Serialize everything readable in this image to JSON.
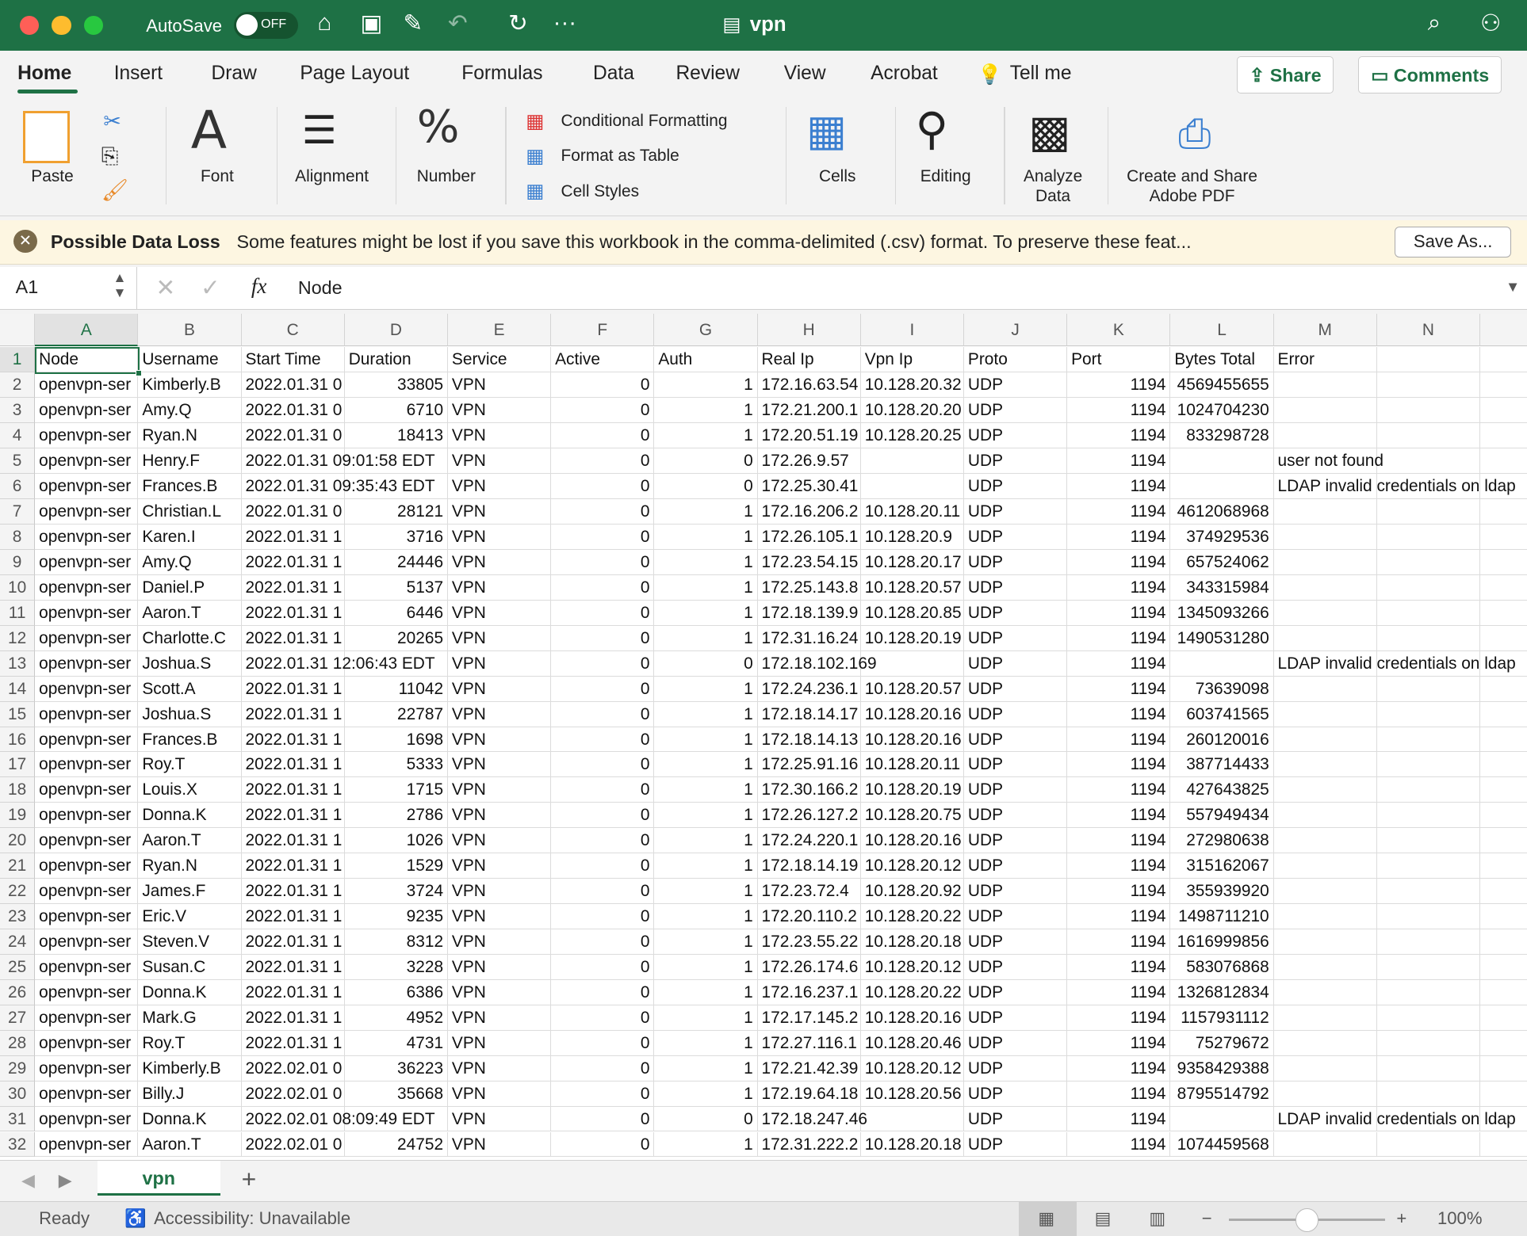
{
  "titlebar": {
    "autosave": "AutoSave",
    "toggle": "OFF",
    "filename": "vpn",
    "icons": [
      "home-icon",
      "save-icon",
      "save-as-icon",
      "undo-icon",
      "redo-icon",
      "more-icon",
      "search-icon",
      "share-people-icon"
    ]
  },
  "tabs": [
    {
      "label": "Home",
      "active": true
    },
    {
      "label": "Insert"
    },
    {
      "label": "Draw"
    },
    {
      "label": "Page Layout"
    },
    {
      "label": "Formulas"
    },
    {
      "label": "Data"
    },
    {
      "label": "Review"
    },
    {
      "label": "View"
    },
    {
      "label": "Acrobat"
    },
    {
      "label": "Tell me"
    }
  ],
  "share": "Share",
  "comments": "Comments",
  "ribbon": {
    "paste": "Paste",
    "font": "Font",
    "alignment": "Alignment",
    "number": "Number",
    "conditional": "Conditional Formatting",
    "format_table": "Format as Table",
    "cell_styles": "Cell Styles",
    "cells": "Cells",
    "editing": "Editing",
    "analyze1": "Analyze",
    "analyze2": "Data",
    "pdf1": "Create and Share",
    "pdf2": "Adobe PDF"
  },
  "warning": {
    "title": "Possible Data Loss",
    "message": "Some features might be lost if you save this workbook in the comma-delimited (.csv) format. To preserve these feat...",
    "button": "Save As..."
  },
  "formula_bar": {
    "name_box": "A1",
    "fx": "fx",
    "value": "Node"
  },
  "accent": "#1e7145",
  "columns": [
    "A",
    "B",
    "C",
    "D",
    "E",
    "F",
    "G",
    "H",
    "I",
    "J",
    "K",
    "L",
    "M",
    "N"
  ],
  "header": [
    "Node",
    "Username",
    "Start Time",
    "Duration",
    "Service",
    "Active",
    "Auth",
    "Real Ip",
    "Vpn Ip",
    "Proto",
    "Port",
    "Bytes Total",
    "Error"
  ],
  "rows": [
    [
      "openvpn-ser",
      "Kimberly.B",
      "2022.01.31 0",
      "33805",
      "VPN",
      "0",
      "1",
      "172.16.63.54",
      "10.128.20.32",
      "UDP",
      "1194",
      "4569455655",
      ""
    ],
    [
      "openvpn-ser",
      "Amy.Q",
      "2022.01.31 0",
      "6710",
      "VPN",
      "0",
      "1",
      "172.21.200.1",
      "10.128.20.20",
      "UDP",
      "1194",
      "1024704230",
      ""
    ],
    [
      "openvpn-ser",
      "Ryan.N",
      "2022.01.31 0",
      "18413",
      "VPN",
      "0",
      "1",
      "172.20.51.19",
      "10.128.20.25",
      "UDP",
      "1194",
      "833298728",
      ""
    ],
    [
      "openvpn-ser",
      "Henry.F",
      "2022.01.31 09:01:58 EDT",
      "",
      "VPN",
      "0",
      "0",
      "172.26.9.57",
      "",
      "UDP",
      "1194",
      "",
      "user not found"
    ],
    [
      "openvpn-ser",
      "Frances.B",
      "2022.01.31 09:35:43 EDT",
      "",
      "VPN",
      "0",
      "0",
      "172.25.30.41",
      "",
      "UDP",
      "1194",
      "",
      "LDAP invalid credentials on ldap"
    ],
    [
      "openvpn-ser",
      "Christian.L",
      "2022.01.31 0",
      "28121",
      "VPN",
      "0",
      "1",
      "172.16.206.2",
      "10.128.20.11",
      "UDP",
      "1194",
      "4612068968",
      ""
    ],
    [
      "openvpn-ser",
      "Karen.I",
      "2022.01.31 1",
      "3716",
      "VPN",
      "0",
      "1",
      "172.26.105.1",
      "10.128.20.9",
      "UDP",
      "1194",
      "374929536",
      ""
    ],
    [
      "openvpn-ser",
      "Amy.Q",
      "2022.01.31 1",
      "24446",
      "VPN",
      "0",
      "1",
      "172.23.54.15",
      "10.128.20.17",
      "UDP",
      "1194",
      "657524062",
      ""
    ],
    [
      "openvpn-ser",
      "Daniel.P",
      "2022.01.31 1",
      "5137",
      "VPN",
      "0",
      "1",
      "172.25.143.8",
      "10.128.20.57",
      "UDP",
      "1194",
      "343315984",
      ""
    ],
    [
      "openvpn-ser",
      "Aaron.T",
      "2022.01.31 1",
      "6446",
      "VPN",
      "0",
      "1",
      "172.18.139.9",
      "10.128.20.85",
      "UDP",
      "1194",
      "1345093266",
      ""
    ],
    [
      "openvpn-ser",
      "Charlotte.C",
      "2022.01.31 1",
      "20265",
      "VPN",
      "0",
      "1",
      "172.31.16.24",
      "10.128.20.19",
      "UDP",
      "1194",
      "1490531280",
      ""
    ],
    [
      "openvpn-ser",
      "Joshua.S",
      "2022.01.31 12:06:43 EDT",
      "",
      "VPN",
      "0",
      "0",
      "172.18.102.169",
      "",
      "UDP",
      "1194",
      "",
      "LDAP invalid credentials on ldap"
    ],
    [
      "openvpn-ser",
      "Scott.A",
      "2022.01.31 1",
      "11042",
      "VPN",
      "0",
      "1",
      "172.24.236.1",
      "10.128.20.57",
      "UDP",
      "1194",
      "73639098",
      ""
    ],
    [
      "openvpn-ser",
      "Joshua.S",
      "2022.01.31 1",
      "22787",
      "VPN",
      "0",
      "1",
      "172.18.14.17",
      "10.128.20.16",
      "UDP",
      "1194",
      "603741565",
      ""
    ],
    [
      "openvpn-ser",
      "Frances.B",
      "2022.01.31 1",
      "1698",
      "VPN",
      "0",
      "1",
      "172.18.14.13",
      "10.128.20.16",
      "UDP",
      "1194",
      "260120016",
      ""
    ],
    [
      "openvpn-ser",
      "Roy.T",
      "2022.01.31 1",
      "5333",
      "VPN",
      "0",
      "1",
      "172.25.91.16",
      "10.128.20.11",
      "UDP",
      "1194",
      "387714433",
      ""
    ],
    [
      "openvpn-ser",
      "Louis.X",
      "2022.01.31 1",
      "1715",
      "VPN",
      "0",
      "1",
      "172.30.166.2",
      "10.128.20.19",
      "UDP",
      "1194",
      "427643825",
      ""
    ],
    [
      "openvpn-ser",
      "Donna.K",
      "2022.01.31 1",
      "2786",
      "VPN",
      "0",
      "1",
      "172.26.127.2",
      "10.128.20.75",
      "UDP",
      "1194",
      "557949434",
      ""
    ],
    [
      "openvpn-ser",
      "Aaron.T",
      "2022.01.31 1",
      "1026",
      "VPN",
      "0",
      "1",
      "172.24.220.1",
      "10.128.20.16",
      "UDP",
      "1194",
      "272980638",
      ""
    ],
    [
      "openvpn-ser",
      "Ryan.N",
      "2022.01.31 1",
      "1529",
      "VPN",
      "0",
      "1",
      "172.18.14.19",
      "10.128.20.12",
      "UDP",
      "1194",
      "315162067",
      ""
    ],
    [
      "openvpn-ser",
      "James.F",
      "2022.01.31 1",
      "3724",
      "VPN",
      "0",
      "1",
      "172.23.72.4",
      "10.128.20.92",
      "UDP",
      "1194",
      "355939920",
      ""
    ],
    [
      "openvpn-ser",
      "Eric.V",
      "2022.01.31 1",
      "9235",
      "VPN",
      "0",
      "1",
      "172.20.110.2",
      "10.128.20.22",
      "UDP",
      "1194",
      "1498711210",
      ""
    ],
    [
      "openvpn-ser",
      "Steven.V",
      "2022.01.31 1",
      "8312",
      "VPN",
      "0",
      "1",
      "172.23.55.22",
      "10.128.20.18",
      "UDP",
      "1194",
      "1616999856",
      ""
    ],
    [
      "openvpn-ser",
      "Susan.C",
      "2022.01.31 1",
      "3228",
      "VPN",
      "0",
      "1",
      "172.26.174.6",
      "10.128.20.12",
      "UDP",
      "1194",
      "583076868",
      ""
    ],
    [
      "openvpn-ser",
      "Donna.K",
      "2022.01.31 1",
      "6386",
      "VPN",
      "0",
      "1",
      "172.16.237.1",
      "10.128.20.22",
      "UDP",
      "1194",
      "1326812834",
      ""
    ],
    [
      "openvpn-ser",
      "Mark.G",
      "2022.01.31 1",
      "4952",
      "VPN",
      "0",
      "1",
      "172.17.145.2",
      "10.128.20.16",
      "UDP",
      "1194",
      "1157931112",
      ""
    ],
    [
      "openvpn-ser",
      "Roy.T",
      "2022.01.31 1",
      "4731",
      "VPN",
      "0",
      "1",
      "172.27.116.1",
      "10.128.20.46",
      "UDP",
      "1194",
      "75279672",
      ""
    ],
    [
      "openvpn-ser",
      "Kimberly.B",
      "2022.02.01 0",
      "36223",
      "VPN",
      "0",
      "1",
      "172.21.42.39",
      "10.128.20.12",
      "UDP",
      "1194",
      "9358429388",
      ""
    ],
    [
      "openvpn-ser",
      "Billy.J",
      "2022.02.01 0",
      "35668",
      "VPN",
      "0",
      "1",
      "172.19.64.18",
      "10.128.20.56",
      "UDP",
      "1194",
      "8795514792",
      ""
    ],
    [
      "openvpn-ser",
      "Donna.K",
      "2022.02.01 08:09:49 EDT",
      "",
      "VPN",
      "0",
      "0",
      "172.18.247.46",
      "",
      "UDP",
      "1194",
      "",
      "LDAP invalid credentials on ldap"
    ],
    [
      "openvpn-ser",
      "Aaron.T",
      "2022.02.01 0",
      "24752",
      "VPN",
      "0",
      "1",
      "172.31.222.2",
      "10.128.20.18",
      "UDP",
      "1194",
      "1074459568",
      ""
    ]
  ],
  "numeric_columns": [
    3,
    5,
    6,
    10,
    11
  ],
  "sheet_tab": "vpn",
  "add_sheet": "+",
  "status": {
    "ready": "Ready",
    "accessibility": "Accessibility: Unavailable",
    "zoom": "100%",
    "zoom_level": 100
  }
}
